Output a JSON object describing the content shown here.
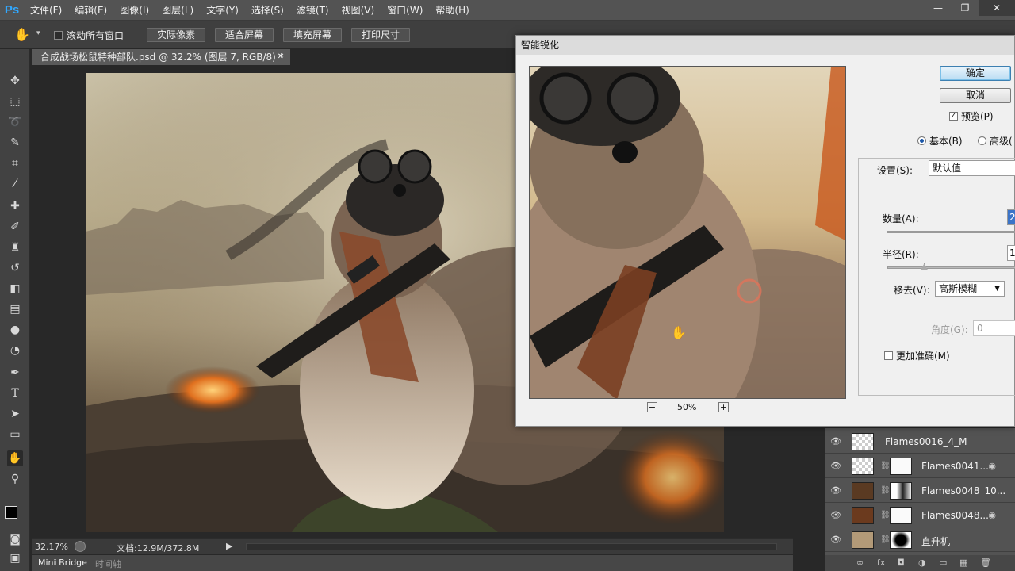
{
  "app": {
    "logo": "Ps",
    "menus": [
      "文件(F)",
      "编辑(E)",
      "图像(I)",
      "图层(L)",
      "文字(Y)",
      "选择(S)",
      "滤镜(T)",
      "视图(V)",
      "窗口(W)",
      "帮助(H)"
    ]
  },
  "window_controls": {
    "minimize": "—",
    "restore": "❐",
    "close": "✕"
  },
  "options_bar": {
    "scroll_all_windows": "滚动所有窗口",
    "buttons": [
      "实际像素",
      "适合屏幕",
      "填充屏幕",
      "打印尺寸"
    ]
  },
  "document": {
    "tab_title": "合成战场松鼠特种部队.psd @ 32.2% (图层 7, RGB/8) *",
    "close": "✕"
  },
  "status": {
    "zoom": "32.17%",
    "doc_size": "文档:12.9M/372.8M"
  },
  "bottom_tabs": [
    "Mini Bridge",
    "时间轴"
  ],
  "dialog": {
    "title": "智能锐化",
    "ok": "确定",
    "cancel": "取消",
    "preview_label": "预览(P)",
    "preview_checked": true,
    "mode_basic": "基本(B)",
    "mode_advanced": "高级(",
    "settings_label": "设置(S):",
    "settings_value": "默认值",
    "amount_label": "数量(A):",
    "amount_value": "2",
    "radius_label": "半径(R):",
    "radius_value": "1",
    "remove_label": "移去(V):",
    "remove_value": "高斯模糊",
    "angle_label": "角度(G):",
    "angle_value": "0",
    "more_accurate": "更加准确(M)",
    "zoom_minus": "−",
    "zoom_value": "50%",
    "zoom_plus": "+"
  },
  "layers": [
    {
      "name": "Flames0016_4_M",
      "has_mask": false,
      "linked": false,
      "fx": false
    },
    {
      "name": "Flames0041...",
      "has_mask": true,
      "linked": true,
      "fx": true
    },
    {
      "name": "Flames0048_10...",
      "has_mask": true,
      "linked": true,
      "fx": false
    },
    {
      "name": "Flames0048...",
      "has_mask": true,
      "linked": true,
      "fx": true
    },
    {
      "name": "直升机",
      "has_mask": true,
      "linked": true,
      "fx": false
    }
  ],
  "layer_footer_icons": [
    "∞",
    "fx",
    "◘",
    "◑",
    "▭",
    "▦",
    "🗑"
  ],
  "colors": {
    "menubar": "#535353",
    "panel": "#424242",
    "accent": "#31a8ff",
    "dialog_bg": "#f0f0f0"
  }
}
